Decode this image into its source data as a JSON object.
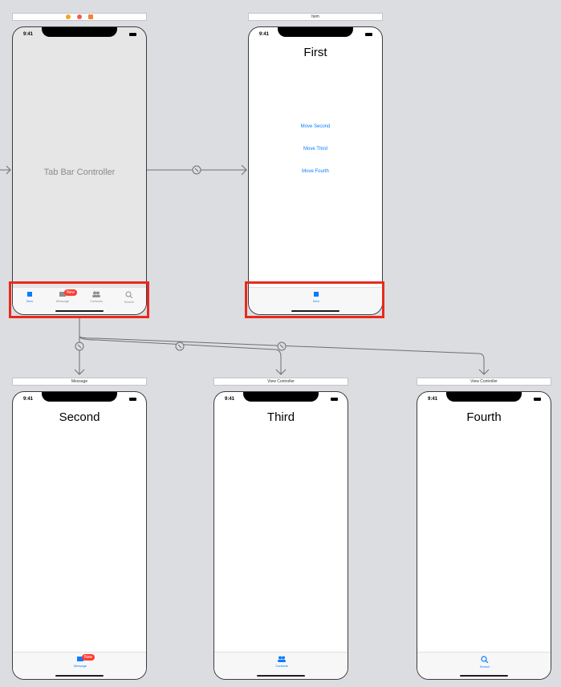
{
  "status_time": "9:41",
  "tab_bar_controller": {
    "label": "Tab Bar Controller",
    "tabs": [
      {
        "label": "Item",
        "icon": "square-icon",
        "active": true
      },
      {
        "label": "Message",
        "icon": "book-icon",
        "badge": "New"
      },
      {
        "label": "Contacts",
        "icon": "contacts-icon"
      },
      {
        "label": "Search",
        "icon": "search-icon"
      }
    ]
  },
  "scenes": {
    "first": {
      "header": "Item",
      "title": "First",
      "tab_label": "Item",
      "buttons": [
        "Move Second",
        "Move Third",
        "Move Fourth"
      ]
    },
    "second": {
      "header": "Message",
      "title": "Second",
      "tab_label": "Message",
      "badge": "New"
    },
    "third": {
      "header": "View Controller",
      "title": "Third",
      "tab_label": "Contacts"
    },
    "fourth": {
      "header": "View Controller",
      "title": "Fourth",
      "tab_label": "Search"
    }
  },
  "colors": {
    "accent": "#0a7cff",
    "badge": "#ff3b30",
    "highlight": "#e8291c",
    "canvas": "#dcdde0"
  }
}
